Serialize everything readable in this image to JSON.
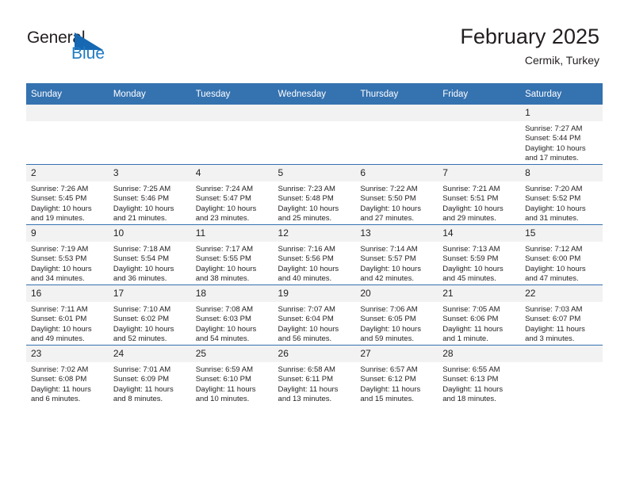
{
  "brand": {
    "name_part1": "General",
    "name_part2": "Blue",
    "logo_icon": "triangle-icon",
    "accent_color": "#1668b3"
  },
  "header": {
    "title": "February 2025",
    "subtitle": "Cermik, Turkey"
  },
  "theme": {
    "header_bg": "#3572b0",
    "daynum_bg": "#f2f2f2",
    "row_divider": "#3572b0",
    "text": "#231f20"
  },
  "calendar": {
    "weekday_headers": [
      "Sunday",
      "Monday",
      "Tuesday",
      "Wednesday",
      "Thursday",
      "Friday",
      "Saturday"
    ],
    "weeks": [
      [
        {
          "day": "",
          "lines": []
        },
        {
          "day": "",
          "lines": []
        },
        {
          "day": "",
          "lines": []
        },
        {
          "day": "",
          "lines": []
        },
        {
          "day": "",
          "lines": []
        },
        {
          "day": "",
          "lines": []
        },
        {
          "day": "1",
          "lines": [
            "Sunrise: 7:27 AM",
            "Sunset: 5:44 PM",
            "Daylight: 10 hours and 17 minutes."
          ],
          "sunrise": "7:27 AM",
          "sunset": "5:44 PM",
          "daylight": "10 hours and 17 minutes."
        }
      ],
      [
        {
          "day": "2",
          "lines": [
            "Sunrise: 7:26 AM",
            "Sunset: 5:45 PM",
            "Daylight: 10 hours and 19 minutes."
          ],
          "sunrise": "7:26 AM",
          "sunset": "5:45 PM",
          "daylight": "10 hours and 19 minutes."
        },
        {
          "day": "3",
          "lines": [
            "Sunrise: 7:25 AM",
            "Sunset: 5:46 PM",
            "Daylight: 10 hours and 21 minutes."
          ],
          "sunrise": "7:25 AM",
          "sunset": "5:46 PM",
          "daylight": "10 hours and 21 minutes."
        },
        {
          "day": "4",
          "lines": [
            "Sunrise: 7:24 AM",
            "Sunset: 5:47 PM",
            "Daylight: 10 hours and 23 minutes."
          ],
          "sunrise": "7:24 AM",
          "sunset": "5:47 PM",
          "daylight": "10 hours and 23 minutes."
        },
        {
          "day": "5",
          "lines": [
            "Sunrise: 7:23 AM",
            "Sunset: 5:48 PM",
            "Daylight: 10 hours and 25 minutes."
          ],
          "sunrise": "7:23 AM",
          "sunset": "5:48 PM",
          "daylight": "10 hours and 25 minutes."
        },
        {
          "day": "6",
          "lines": [
            "Sunrise: 7:22 AM",
            "Sunset: 5:50 PM",
            "Daylight: 10 hours and 27 minutes."
          ],
          "sunrise": "7:22 AM",
          "sunset": "5:50 PM",
          "daylight": "10 hours and 27 minutes."
        },
        {
          "day": "7",
          "lines": [
            "Sunrise: 7:21 AM",
            "Sunset: 5:51 PM",
            "Daylight: 10 hours and 29 minutes."
          ],
          "sunrise": "7:21 AM",
          "sunset": "5:51 PM",
          "daylight": "10 hours and 29 minutes."
        },
        {
          "day": "8",
          "lines": [
            "Sunrise: 7:20 AM",
            "Sunset: 5:52 PM",
            "Daylight: 10 hours and 31 minutes."
          ],
          "sunrise": "7:20 AM",
          "sunset": "5:52 PM",
          "daylight": "10 hours and 31 minutes."
        }
      ],
      [
        {
          "day": "9",
          "lines": [
            "Sunrise: 7:19 AM",
            "Sunset: 5:53 PM",
            "Daylight: 10 hours and 34 minutes."
          ],
          "sunrise": "7:19 AM",
          "sunset": "5:53 PM",
          "daylight": "10 hours and 34 minutes."
        },
        {
          "day": "10",
          "lines": [
            "Sunrise: 7:18 AM",
            "Sunset: 5:54 PM",
            "Daylight: 10 hours and 36 minutes."
          ],
          "sunrise": "7:18 AM",
          "sunset": "5:54 PM",
          "daylight": "10 hours and 36 minutes."
        },
        {
          "day": "11",
          "lines": [
            "Sunrise: 7:17 AM",
            "Sunset: 5:55 PM",
            "Daylight: 10 hours and 38 minutes."
          ],
          "sunrise": "7:17 AM",
          "sunset": "5:55 PM",
          "daylight": "10 hours and 38 minutes."
        },
        {
          "day": "12",
          "lines": [
            "Sunrise: 7:16 AM",
            "Sunset: 5:56 PM",
            "Daylight: 10 hours and 40 minutes."
          ],
          "sunrise": "7:16 AM",
          "sunset": "5:56 PM",
          "daylight": "10 hours and 40 minutes."
        },
        {
          "day": "13",
          "lines": [
            "Sunrise: 7:14 AM",
            "Sunset: 5:57 PM",
            "Daylight: 10 hours and 42 minutes."
          ],
          "sunrise": "7:14 AM",
          "sunset": "5:57 PM",
          "daylight": "10 hours and 42 minutes."
        },
        {
          "day": "14",
          "lines": [
            "Sunrise: 7:13 AM",
            "Sunset: 5:59 PM",
            "Daylight: 10 hours and 45 minutes."
          ],
          "sunrise": "7:13 AM",
          "sunset": "5:59 PM",
          "daylight": "10 hours and 45 minutes."
        },
        {
          "day": "15",
          "lines": [
            "Sunrise: 7:12 AM",
            "Sunset: 6:00 PM",
            "Daylight: 10 hours and 47 minutes."
          ],
          "sunrise": "7:12 AM",
          "sunset": "6:00 PM",
          "daylight": "10 hours and 47 minutes."
        }
      ],
      [
        {
          "day": "16",
          "lines": [
            "Sunrise: 7:11 AM",
            "Sunset: 6:01 PM",
            "Daylight: 10 hours and 49 minutes."
          ],
          "sunrise": "7:11 AM",
          "sunset": "6:01 PM",
          "daylight": "10 hours and 49 minutes."
        },
        {
          "day": "17",
          "lines": [
            "Sunrise: 7:10 AM",
            "Sunset: 6:02 PM",
            "Daylight: 10 hours and 52 minutes."
          ],
          "sunrise": "7:10 AM",
          "sunset": "6:02 PM",
          "daylight": "10 hours and 52 minutes."
        },
        {
          "day": "18",
          "lines": [
            "Sunrise: 7:08 AM",
            "Sunset: 6:03 PM",
            "Daylight: 10 hours and 54 minutes."
          ],
          "sunrise": "7:08 AM",
          "sunset": "6:03 PM",
          "daylight": "10 hours and 54 minutes."
        },
        {
          "day": "19",
          "lines": [
            "Sunrise: 7:07 AM",
            "Sunset: 6:04 PM",
            "Daylight: 10 hours and 56 minutes."
          ],
          "sunrise": "7:07 AM",
          "sunset": "6:04 PM",
          "daylight": "10 hours and 56 minutes."
        },
        {
          "day": "20",
          "lines": [
            "Sunrise: 7:06 AM",
            "Sunset: 6:05 PM",
            "Daylight: 10 hours and 59 minutes."
          ],
          "sunrise": "7:06 AM",
          "sunset": "6:05 PM",
          "daylight": "10 hours and 59 minutes."
        },
        {
          "day": "21",
          "lines": [
            "Sunrise: 7:05 AM",
            "Sunset: 6:06 PM",
            "Daylight: 11 hours and 1 minute."
          ],
          "sunrise": "7:05 AM",
          "sunset": "6:06 PM",
          "daylight": "11 hours and 1 minute."
        },
        {
          "day": "22",
          "lines": [
            "Sunrise: 7:03 AM",
            "Sunset: 6:07 PM",
            "Daylight: 11 hours and 3 minutes."
          ],
          "sunrise": "7:03 AM",
          "sunset": "6:07 PM",
          "daylight": "11 hours and 3 minutes."
        }
      ],
      [
        {
          "day": "23",
          "lines": [
            "Sunrise: 7:02 AM",
            "Sunset: 6:08 PM",
            "Daylight: 11 hours and 6 minutes."
          ],
          "sunrise": "7:02 AM",
          "sunset": "6:08 PM",
          "daylight": "11 hours and 6 minutes."
        },
        {
          "day": "24",
          "lines": [
            "Sunrise: 7:01 AM",
            "Sunset: 6:09 PM",
            "Daylight: 11 hours and 8 minutes."
          ],
          "sunrise": "7:01 AM",
          "sunset": "6:09 PM",
          "daylight": "11 hours and 8 minutes."
        },
        {
          "day": "25",
          "lines": [
            "Sunrise: 6:59 AM",
            "Sunset: 6:10 PM",
            "Daylight: 11 hours and 10 minutes."
          ],
          "sunrise": "6:59 AM",
          "sunset": "6:10 PM",
          "daylight": "11 hours and 10 minutes."
        },
        {
          "day": "26",
          "lines": [
            "Sunrise: 6:58 AM",
            "Sunset: 6:11 PM",
            "Daylight: 11 hours and 13 minutes."
          ],
          "sunrise": "6:58 AM",
          "sunset": "6:11 PM",
          "daylight": "11 hours and 13 minutes."
        },
        {
          "day": "27",
          "lines": [
            "Sunrise: 6:57 AM",
            "Sunset: 6:12 PM",
            "Daylight: 11 hours and 15 minutes."
          ],
          "sunrise": "6:57 AM",
          "sunset": "6:12 PM",
          "daylight": "11 hours and 15 minutes."
        },
        {
          "day": "28",
          "lines": [
            "Sunrise: 6:55 AM",
            "Sunset: 6:13 PM",
            "Daylight: 11 hours and 18 minutes."
          ],
          "sunrise": "6:55 AM",
          "sunset": "6:13 PM",
          "daylight": "11 hours and 18 minutes."
        },
        {
          "day": "",
          "lines": []
        }
      ]
    ]
  }
}
